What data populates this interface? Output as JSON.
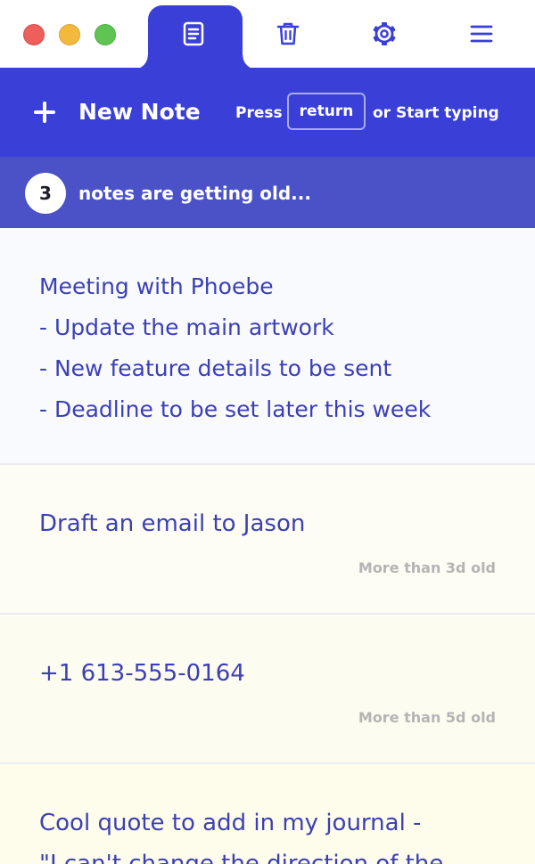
{
  "toolbar": {
    "tabs": [
      {
        "icon": "notes-icon",
        "active": true
      },
      {
        "icon": "trash-icon",
        "active": false
      },
      {
        "icon": "gear-icon",
        "active": false
      },
      {
        "icon": "menu-icon",
        "active": false
      }
    ]
  },
  "new_note": {
    "label": "New Note",
    "hint_prefix": "Press",
    "hint_key": "return",
    "hint_suffix": "or Start typing"
  },
  "old_notes": {
    "count": "3",
    "label": "notes are getting old..."
  },
  "notes": [
    {
      "text": "Meeting with Phoebe\n- Update the main artwork\n- New feature details to be sent\n- Deadline to be set later this week",
      "age": ""
    },
    {
      "text": "Draft an email to Jason",
      "age": "More than 3d old"
    },
    {
      "text": "+1 613-555-0164",
      "age": "More than 5d old"
    },
    {
      "text": "Cool quote to add in my journal -\n\"I can't change the direction of the",
      "age": ""
    }
  ],
  "colors": {
    "accent": "#3a3fd8",
    "banner": "#4b52c8",
    "note_text": "#3b3fb6",
    "age_text": "#b4b4b4"
  }
}
